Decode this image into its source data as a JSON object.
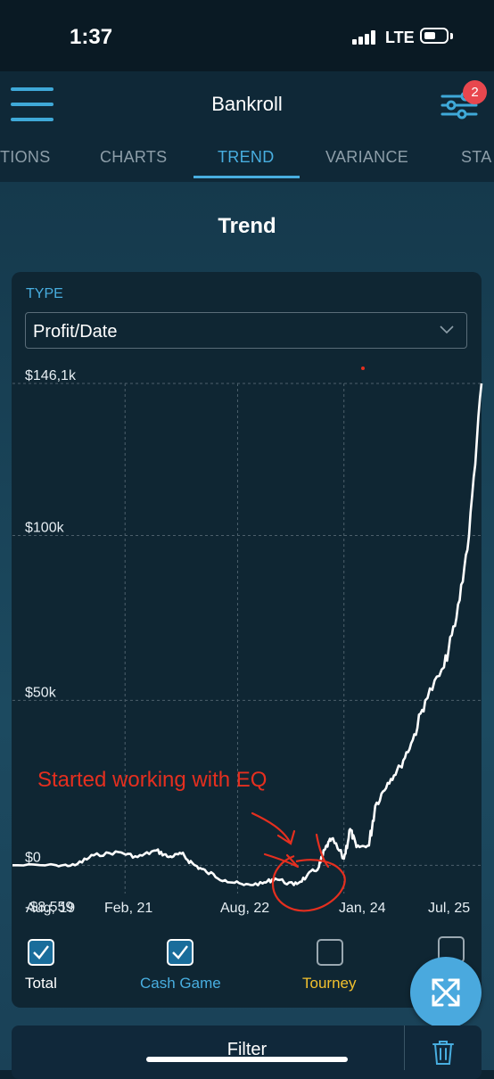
{
  "status_bar": {
    "time": "1:37",
    "network": "LTE"
  },
  "header": {
    "title": "Bankroll",
    "filter_badge": "2"
  },
  "tabs": [
    {
      "label": "TIONS",
      "active": false
    },
    {
      "label": "CHARTS",
      "active": false
    },
    {
      "label": "TREND",
      "active": true
    },
    {
      "label": "VARIANCE",
      "active": false
    },
    {
      "label": "STA",
      "active": false
    }
  ],
  "page_title": "Trend",
  "type_selector": {
    "label": "TYPE",
    "value": "Profit/Date"
  },
  "chart_data": {
    "type": "line",
    "title": "",
    "xlabel": "",
    "ylabel": "",
    "y_tick_labels": [
      "$146,1k",
      "$100k",
      "$50k",
      "$0",
      "-$8.559"
    ],
    "x_tick_labels": [
      "Aug, 19",
      "Feb, 21",
      "Aug, 22",
      "Jan, 24",
      "Jul, 25"
    ],
    "ylim": [
      -8559,
      146100
    ],
    "xlim": [
      "2019-08",
      "2025-11"
    ],
    "grid": true,
    "series": [
      {
        "color": "#ffffff",
        "points": [
          [
            "2019-08",
            0
          ],
          [
            "2020-03",
            0
          ],
          [
            "2020-06",
            0
          ],
          [
            "2020-09",
            3000
          ],
          [
            "2021-01",
            4000
          ],
          [
            "2021-04",
            2500
          ],
          [
            "2021-07",
            4500
          ],
          [
            "2021-09",
            2500
          ],
          [
            "2021-11",
            3500
          ],
          [
            "2022-01",
            200
          ],
          [
            "2022-03",
            -2000
          ],
          [
            "2022-06",
            -4500
          ],
          [
            "2022-09",
            -6000
          ],
          [
            "2022-12",
            -5500
          ],
          [
            "2023-02",
            -4000
          ],
          [
            "2023-05",
            -6000
          ],
          [
            "2023-07",
            -3500
          ],
          [
            "2023-09",
            -500
          ],
          [
            "2023-10",
            5000
          ],
          [
            "2023-11",
            8000
          ],
          [
            "2024-01",
            2000
          ],
          [
            "2024-02",
            11000
          ],
          [
            "2024-03",
            5500
          ],
          [
            "2024-05",
            6000
          ],
          [
            "2024-06",
            18000
          ],
          [
            "2024-08",
            25000
          ],
          [
            "2024-10",
            30000
          ],
          [
            "2024-12",
            38000
          ],
          [
            "2025-02",
            50000
          ],
          [
            "2025-05",
            60000
          ],
          [
            "2025-07",
            75000
          ],
          [
            "2025-09",
            100000
          ],
          [
            "2025-11",
            146100
          ]
        ]
      }
    ]
  },
  "annotation": {
    "text": "Started working with EQ",
    "color": "#e52f1f"
  },
  "legend": [
    {
      "label": "Total",
      "checked": true,
      "color": "#ffffff"
    },
    {
      "label": "Cash Game",
      "checked": true,
      "color": "#48aee0"
    },
    {
      "label": "Tourney",
      "checked": false,
      "color": "#f2c12e"
    },
    {
      "label": "",
      "checked": false,
      "color": "#ffffff"
    }
  ],
  "bottom_bar": {
    "filter_label": "Filter"
  },
  "icons": {
    "menu": "hamburger-menu-icon",
    "filter": "sliders-filter-icon",
    "expand": "expand-arrows-icon",
    "trash": "trash-icon",
    "chevron": "chevron-down-icon"
  },
  "colors": {
    "accent": "#48aee0",
    "background": "#0d2331",
    "card": "#0f2633",
    "badge": "#e8474e"
  }
}
